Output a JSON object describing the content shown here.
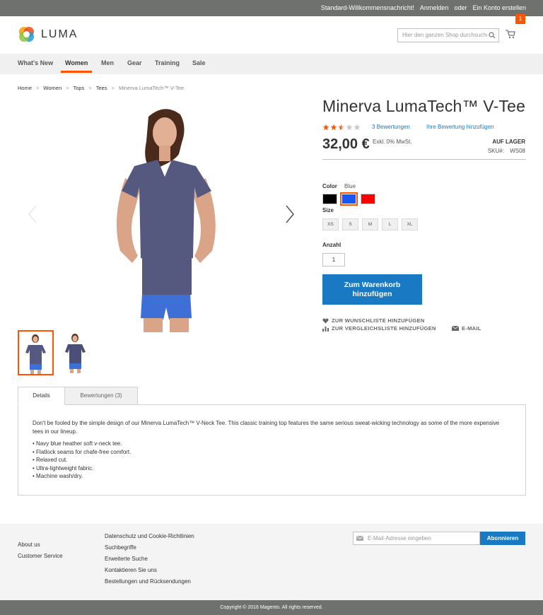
{
  "topbar": {
    "welcome": "Standard-Willkommensnachricht!",
    "sign_in": "Anmelden",
    "or": "oder",
    "create_account": "Ein Konto erstellen"
  },
  "header": {
    "logo_text": "LUMA",
    "search_placeholder": "Hier den ganzen Shop durchsuchen...",
    "cart_count": "1"
  },
  "nav": {
    "items": [
      "What's New",
      "Women",
      "Men",
      "Gear",
      "Training",
      "Sale"
    ],
    "active": "Women"
  },
  "breadcrumbs": [
    "Home",
    "Women",
    "Tops",
    "Tees",
    "Minerva LumaTech™ V-Tee"
  ],
  "product": {
    "title": "Minerva LumaTech™ V-Tee",
    "rating": 2.5,
    "reviews_link": "3 Bewertungen",
    "add_review": "Ihre Bewertung hinzufügen",
    "price": "32,00 €",
    "tax_note": "Exkl. 0% MwSt.",
    "stock": "AUF LAGER",
    "sku_label": "SKU#:",
    "sku": "WS08",
    "color_label": "Color",
    "color_value": "Blue",
    "colors": [
      "#000000",
      "#1857f7",
      "#ff0000"
    ],
    "selected_color": "#1857f7",
    "size_label": "Size",
    "sizes": [
      "XS",
      "S",
      "M",
      "L",
      "XL"
    ],
    "qty_label": "Anzahl",
    "qty": "1",
    "add_to_cart": "Zum Warenkorb hinzufügen",
    "wishlist": "ZUR WUNSCHLISTE HINZUFÜGEN",
    "compare": "ZUR VERGLEICHSLISTE HINZUFÜGEN",
    "email": "E-MAIL"
  },
  "tabs": {
    "details": "Details",
    "reviews": "Bewertungen (3)",
    "description": "Don't be fooled by the simple design of our Minerva LumaTech™ V-Neck Tee. This classic training top features the same serious sweat-wicking technology as some of the more expensive tees in our lineup.",
    "bullets": [
      "• Navy blue heather soft v-neck tee.",
      "• Flatlock seams for chafe-free comfort.",
      "• Relaxed cut.",
      "• Ultra-lightweight fabric.",
      "• Machine wash/dry."
    ]
  },
  "footer": {
    "col1": [
      "About us",
      "Customer Service"
    ],
    "col2": [
      "Datenschutz und Cookie-Richtlinien",
      "Suchbegriffe",
      "Erweiterte Suche",
      "Kontaktieren Sie uns",
      "Bestellungen und Rücksendungen"
    ],
    "newsletter_placeholder": "E-Mail-Adresse eingeben",
    "subscribe": "Abonnieren",
    "copyright": "Copyright © 2016 Magento. All rights reserved."
  },
  "colors": {
    "accent": "#ff5501",
    "link": "#1979c3",
    "topbar": "#6e716e"
  }
}
